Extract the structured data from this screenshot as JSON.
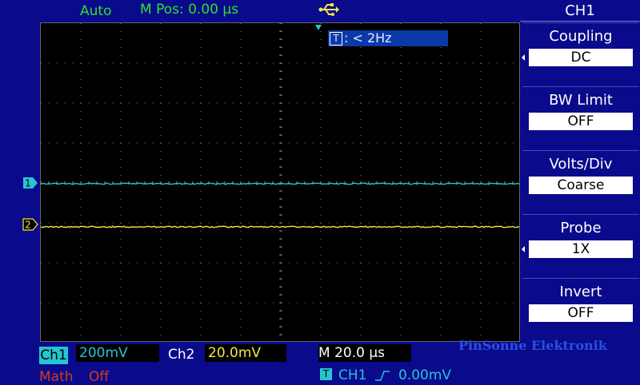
{
  "status": {
    "mode": "Auto",
    "mpos_label": "M Pos:",
    "mpos_value": "0.00",
    "mpos_unit": "µs",
    "usb_icon": "usb-icon"
  },
  "trigger_freq": {
    "tag": "T",
    "text": ": < 2Hz"
  },
  "channels": {
    "ch1_marker": "1",
    "ch2_marker": "2",
    "ch1_color": "#26c5d0",
    "ch2_color": "#f0e840"
  },
  "menu": {
    "title": "CH1",
    "items": [
      {
        "label": "Coupling",
        "value": "DC",
        "arrow": true
      },
      {
        "label": "BW Limit",
        "value": "OFF",
        "arrow": false
      },
      {
        "label": "Volts/Div",
        "value": "Coarse",
        "arrow": false
      },
      {
        "label": "Probe",
        "value": "1X",
        "arrow": true
      },
      {
        "label": "Invert",
        "value": "OFF",
        "arrow": false
      }
    ]
  },
  "bottom": {
    "ch1_tag": "Ch1",
    "ch1_volts": "200mV",
    "ch2_tag": "Ch2",
    "ch2_volts": "20.0mV",
    "timebase": "M 20.0 µs",
    "math_label": "Math",
    "math_state": "Off",
    "trig_tag": "T",
    "trig_source": "CH1",
    "trig_level": "0.00mV",
    "watermark": "PinSonne Elektronik"
  }
}
